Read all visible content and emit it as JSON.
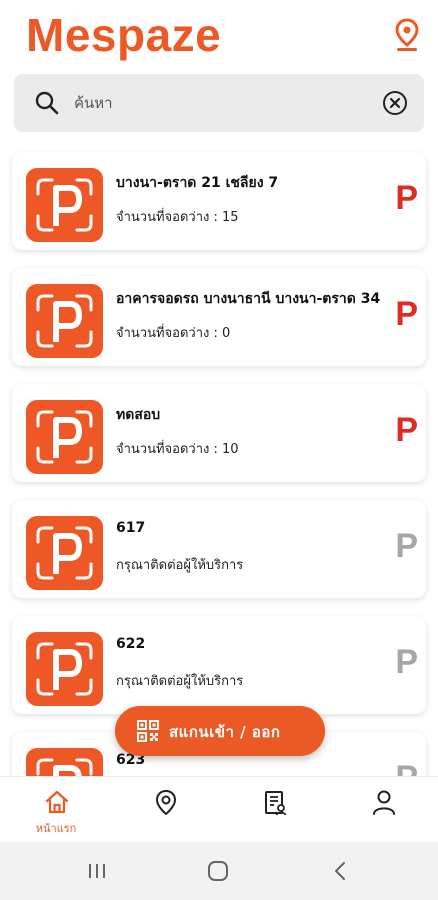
{
  "app": {
    "title": "Mespaze"
  },
  "search": {
    "placeholder": "ค้นหา",
    "value": ""
  },
  "parkings": [
    {
      "name": "บางนา-ตราด 21 เชลียง 7",
      "status": "จำนวนที่จอดว่าง : 15",
      "available": true
    },
    {
      "name": "อาคารจอดรถ บางนาธานี บางนา-ตราด 34",
      "status": "จำนวนที่จอดว่าง : 0",
      "available": true
    },
    {
      "name": "ทดสอบ",
      "status": "จำนวนที่จอดว่าง : 10",
      "available": true
    },
    {
      "name": "617",
      "status": "กรุณาติดต่อผู้ให้บริการ",
      "available": false
    },
    {
      "name": "622",
      "status": "กรุณาติดต่อผู้ให้บริการ",
      "available": false
    },
    {
      "name": "623",
      "status": "",
      "available": false
    }
  ],
  "p_mark": "P",
  "scan_button": {
    "label": "สแกนเข้า / ออก",
    "icon": "qr-code-icon"
  },
  "tabs": [
    {
      "id": "home",
      "label": "หน้าแรก",
      "icon": "home-icon",
      "active": true
    },
    {
      "id": "map",
      "label": "",
      "icon": "map-pin-icon",
      "active": false
    },
    {
      "id": "history",
      "label": "",
      "icon": "receipt-icon",
      "active": false
    },
    {
      "id": "profile",
      "label": "",
      "icon": "user-icon",
      "active": false
    }
  ],
  "colors": {
    "brand": "#EB5A25",
    "available": "#E02A24",
    "unavailable": "#A6A6A6",
    "tab_active": "#EB5A25",
    "tab_inactive": "#222222"
  }
}
